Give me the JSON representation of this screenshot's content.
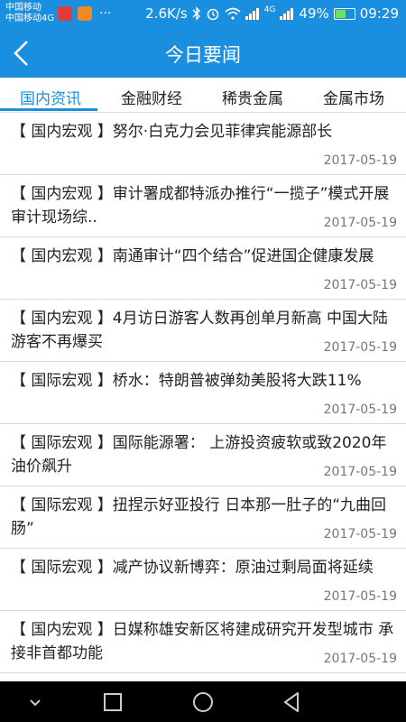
{
  "status_bar": {
    "carrier_1": "中国移动",
    "carrier_2": "中国移动4G",
    "more_dots": "···",
    "speed": "2.6K/s",
    "battery": "49%",
    "time": "09:29",
    "network": "4G",
    "app_icons": [
      "huawei-app-icon",
      "orange-app-icon"
    ],
    "icons": [
      "bluetooth-icon",
      "alarm-icon",
      "wifi-icon",
      "signal-icon",
      "battery-icon"
    ],
    "battery_level": 0.49,
    "colors": {
      "bar": "#1a8fe0",
      "battery_fill": "#6ee06e"
    }
  },
  "app_bar": {
    "title": "今日要闻",
    "back_icon": "chevron-left-icon"
  },
  "tabs": [
    {
      "label": "国内资讯",
      "active": true
    },
    {
      "label": "金融财经",
      "active": false
    },
    {
      "label": "稀贵金属",
      "active": false
    },
    {
      "label": "金属市场",
      "active": false
    }
  ],
  "news": [
    {
      "headline": "【 国内宏观 】努尔·白克力会见菲律宾能源部长",
      "date": "2017-05-19"
    },
    {
      "headline": "【 国内宏观 】审计署成都特派办推行“一揽子”模式开展审计现场综..",
      "date": "2017-05-19"
    },
    {
      "headline": "【 国内宏观 】南通审计“四个结合”促进国企健康发展",
      "date": "2017-05-19"
    },
    {
      "headline": "【 国内宏观 】4月访日游客人数再创单月新高 中国大陆游客不再爆买",
      "date": "2017-05-19"
    },
    {
      "headline": "【 国际宏观 】桥水：特朗普被弹劾美股将大跌11%",
      "date": "2017-05-19"
    },
    {
      "headline": "【 国际宏观 】国际能源署： 上游投资疲软或致2020年油价飙升",
      "date": "2017-05-19"
    },
    {
      "headline": "【 国际宏观 】扭捏示好亚投行 日本那一肚子的“九曲回肠”",
      "date": "2017-05-19"
    },
    {
      "headline": "【 国际宏观 】减产协议新博弈：原油过剩局面将延续",
      "date": "2017-05-19"
    },
    {
      "headline": "【 国内宏观 】日媒称雄安新区将建成研究开发型城市 承接非首都功能",
      "date": "2017-05-19"
    }
  ],
  "nav_bar": {
    "buttons": [
      "chevron-down-icon",
      "recents-square-icon",
      "home-circle-icon",
      "back-triangle-icon"
    ]
  },
  "theme": {
    "primary": "#1a8fe0",
    "text": "#222222",
    "date": "#777777"
  }
}
